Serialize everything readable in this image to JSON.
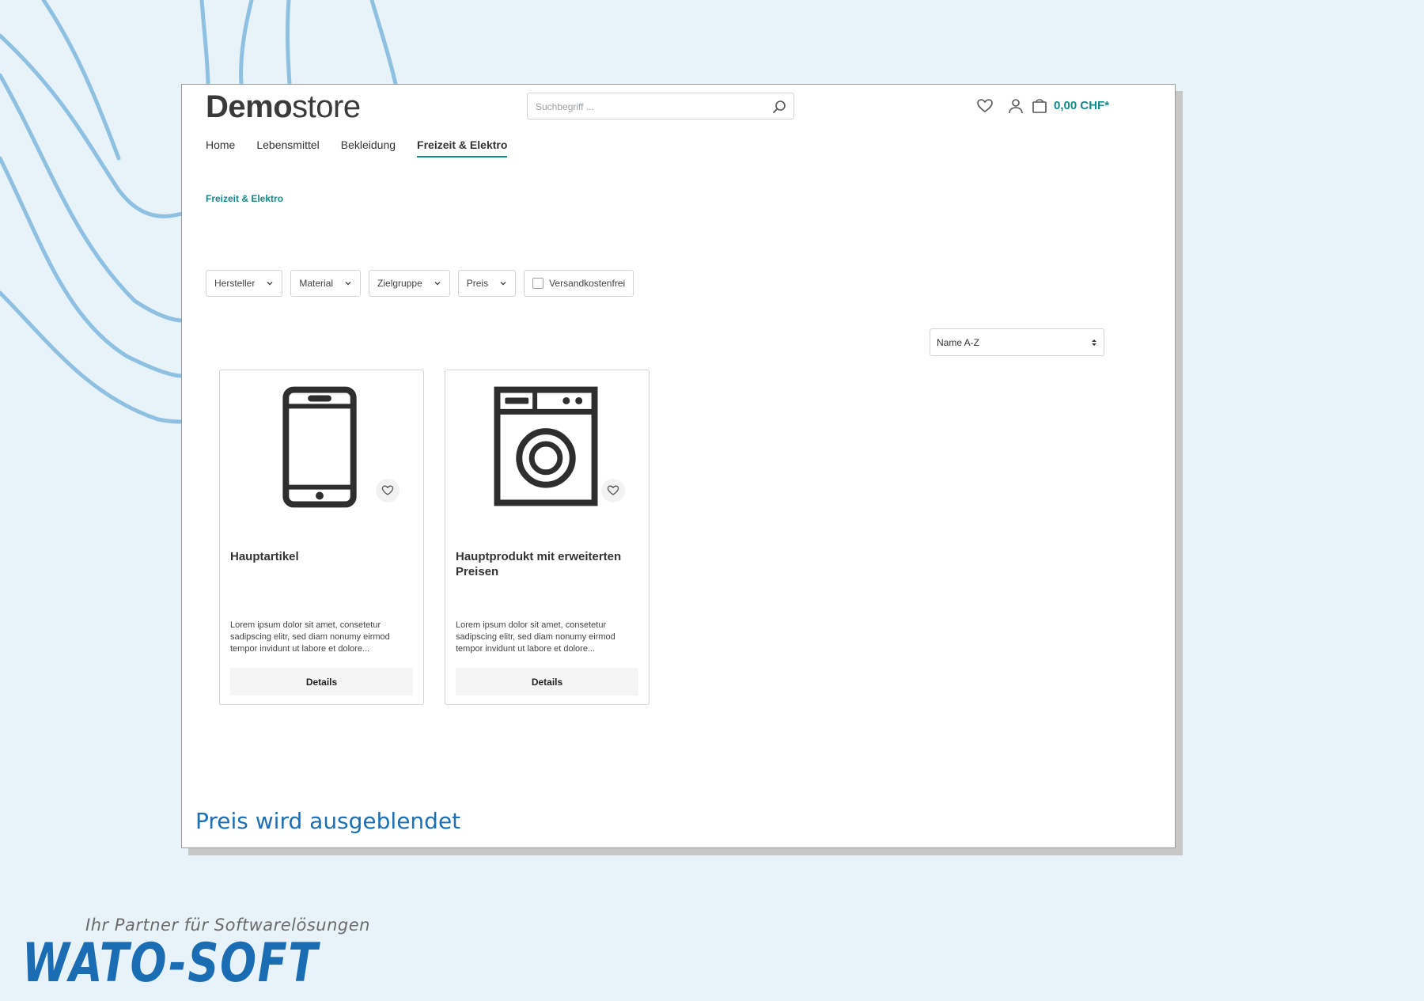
{
  "header": {
    "logo_bold": "Demo",
    "logo_light": "store",
    "search_placeholder": "Suchbegriff ...",
    "cart_total": "0,00 CHF*"
  },
  "nav": {
    "items": [
      "Home",
      "Lebensmittel",
      "Bekleidung",
      "Freizeit & Elektro"
    ],
    "active": "Freizeit & Elektro"
  },
  "breadcrumb": "Freizeit & Elektro",
  "filters": [
    "Hersteller",
    "Material",
    "Zielgruppe",
    "Preis"
  ],
  "filter_checkbox": {
    "label": "Versandkostenfrei",
    "checked": false
  },
  "sort": {
    "selected": "Name A-Z"
  },
  "products": [
    {
      "title": "Hauptartikel",
      "description": "Lorem ipsum dolor sit amet, consetetur sadipscing elitr, sed diam nonumy eirmod tempor invidunt ut labore et dolore...",
      "button": "Details",
      "icon": "smartphone-icon"
    },
    {
      "title": "Hauptprodukt mit erweiterten Preisen",
      "description": "Lorem ipsum dolor sit amet, consetetur sadipscing elitr, sed diam nonumy eirmod tempor invidunt ut labore et dolore...",
      "button": "Details",
      "icon": "washing-machine-icon"
    }
  ],
  "caption": "Preis wird ausgeblendet",
  "brand": {
    "tagline": "Ihr Partner für Softwarelösungen",
    "name": "WATO-SOFT"
  },
  "colors": {
    "accent": "#0f8a8a",
    "caption_blue": "#1a6fb5",
    "brand_blue": "#1b6db3",
    "background": "#e8f2f9",
    "decor_lines": "#8ec0e2"
  }
}
